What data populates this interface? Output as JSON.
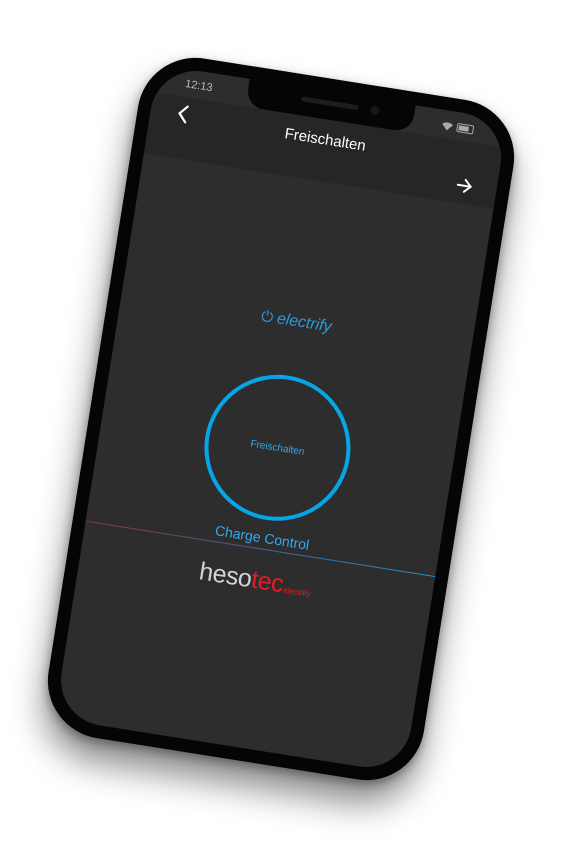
{
  "status_bar": {
    "time": "12:13"
  },
  "nav": {
    "title": "Freischalten",
    "back_icon": "back-arrow-icon",
    "next_icon": "forward-arrow-icon"
  },
  "brand": {
    "power_symbol": "⏻",
    "name": "electrify"
  },
  "unlock_button": {
    "label": "Freischalten"
  },
  "app_title": "Charge Control",
  "company_logo": {
    "part1": "heso",
    "part2": "tec",
    "sub": "electrify"
  },
  "colors": {
    "accent_blue": "#06a6e6",
    "logo_red": "#e21d23",
    "background": "#2d2d2d"
  }
}
